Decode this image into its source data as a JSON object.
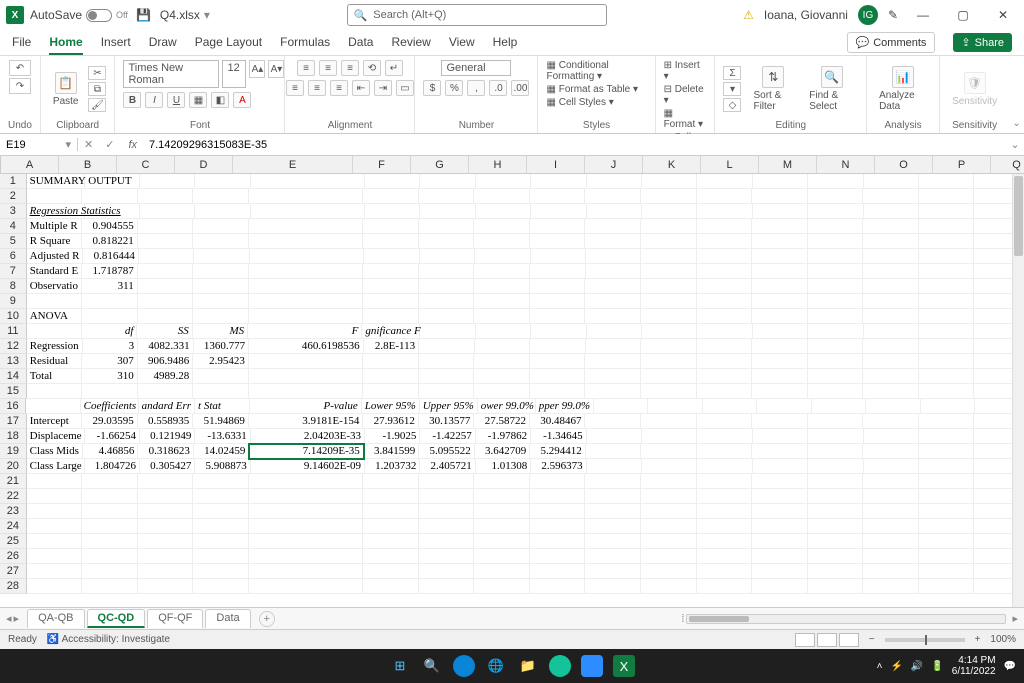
{
  "titlebar": {
    "autosave_label": "AutoSave",
    "autosave_state": "Off",
    "filename": "Q4.xlsx",
    "search_placeholder": "Search (Alt+Q)",
    "username": "Ioana, Giovanni",
    "user_initials": "IG"
  },
  "menu": {
    "tabs": [
      "File",
      "Home",
      "Insert",
      "Draw",
      "Page Layout",
      "Formulas",
      "Data",
      "Review",
      "View",
      "Help"
    ],
    "active_index": 1,
    "comments": "Comments",
    "share": "Share"
  },
  "ribbon": {
    "undo": "Undo",
    "clipboard": "Clipboard",
    "font_name": "Times New Roman",
    "font_size": "12",
    "font_label": "Font",
    "alignment_label": "Alignment",
    "number_format": "General",
    "number_label": "Number",
    "styles": {
      "cond": "Conditional Formatting",
      "table": "Format as Table",
      "cell": "Cell Styles",
      "label": "Styles"
    },
    "cells": {
      "insert": "Insert",
      "delete": "Delete",
      "format": "Format",
      "label": "Cells"
    },
    "editing": {
      "sort": "Sort & Filter",
      "find": "Find & Select",
      "label": "Editing"
    },
    "analysis": {
      "analyze": "Analyze Data",
      "label": "Analysis"
    },
    "sensitivity": {
      "btn": "Sensitivity",
      "label": "Sensitivity"
    }
  },
  "formula_bar": {
    "cell_ref": "E19",
    "formula": "7.14209296315083E-35"
  },
  "columns": [
    {
      "l": "A",
      "w": 58
    },
    {
      "l": "B",
      "w": 58
    },
    {
      "l": "C",
      "w": 58
    },
    {
      "l": "D",
      "w": 58
    },
    {
      "l": "E",
      "w": 120
    },
    {
      "l": "F",
      "w": 58
    },
    {
      "l": "G",
      "w": 58
    },
    {
      "l": "H",
      "w": 58
    },
    {
      "l": "I",
      "w": 58
    },
    {
      "l": "J",
      "w": 58
    },
    {
      "l": "K",
      "w": 58
    },
    {
      "l": "L",
      "w": 58
    },
    {
      "l": "M",
      "w": 58
    },
    {
      "l": "N",
      "w": 58
    },
    {
      "l": "O",
      "w": 58
    },
    {
      "l": "P",
      "w": 58
    },
    {
      "l": "Q",
      "w": 52
    }
  ],
  "row_count": 28,
  "cells": {
    "1": {
      "A": {
        "t": "SUMMARY OUTPUT",
        "span": 3
      }
    },
    "3": {
      "A": {
        "t": "Regression Statistics",
        "span": 3,
        "ital": true,
        "u": true
      }
    },
    "4": {
      "A": {
        "t": "Multiple R",
        "span": 1
      },
      "B": {
        "t": "0.904555",
        "num": true
      }
    },
    "5": {
      "A": {
        "t": "R Square"
      },
      "B": {
        "t": "0.818221",
        "num": true
      }
    },
    "6": {
      "A": {
        "t": "Adjusted R"
      },
      "B": {
        "t": "0.816444",
        "num": true
      }
    },
    "7": {
      "A": {
        "t": "Standard E"
      },
      "B": {
        "t": "1.718787",
        "num": true
      }
    },
    "8": {
      "A": {
        "t": "Observatio"
      },
      "B": {
        "t": "311",
        "num": true
      }
    },
    "10": {
      "A": {
        "t": "ANOVA"
      }
    },
    "11": {
      "B": {
        "t": "df",
        "ital": true,
        "num": true
      },
      "C": {
        "t": "SS",
        "ital": true,
        "num": true
      },
      "D": {
        "t": "MS",
        "ital": true,
        "num": true
      },
      "E": {
        "t": "F",
        "ital": true,
        "num": true
      },
      "F": {
        "t": "gnificance F",
        "ital": true
      }
    },
    "12": {
      "A": {
        "t": "Regression"
      },
      "B": {
        "t": "3",
        "num": true
      },
      "C": {
        "t": "4082.331",
        "num": true
      },
      "D": {
        "t": "1360.777",
        "num": true
      },
      "E": {
        "t": "460.6198536",
        "num": true
      },
      "F": {
        "t": "2.8E-113",
        "num": true
      }
    },
    "13": {
      "A": {
        "t": "Residual"
      },
      "B": {
        "t": "307",
        "num": true
      },
      "C": {
        "t": "906.9486",
        "num": true
      },
      "D": {
        "t": "2.95423",
        "num": true
      }
    },
    "14": {
      "A": {
        "t": "Total"
      },
      "B": {
        "t": "310",
        "num": true
      },
      "C": {
        "t": "4989.28",
        "num": true
      }
    },
    "16": {
      "B": {
        "t": "Coefficients",
        "ital": true
      },
      "C": {
        "t": "andard Err",
        "ital": true
      },
      "D": {
        "t": "t Stat",
        "ital": true
      },
      "E": {
        "t": "P-value",
        "ital": true,
        "num": true
      },
      "F": {
        "t": "Lower 95%",
        "ital": true
      },
      "G": {
        "t": "Upper 95%",
        "ital": true
      },
      "H": {
        "t": "ower 99.0%",
        "ital": true
      },
      "I": {
        "t": "pper 99.0%",
        "ital": true
      }
    },
    "17": {
      "A": {
        "t": "Intercept"
      },
      "B": {
        "t": "29.03595",
        "num": true
      },
      "C": {
        "t": "0.558935",
        "num": true
      },
      "D": {
        "t": "51.94869",
        "num": true
      },
      "E": {
        "t": "3.9181E-154",
        "num": true
      },
      "F": {
        "t": "27.93612",
        "num": true
      },
      "G": {
        "t": "30.13577",
        "num": true
      },
      "H": {
        "t": "27.58722",
        "num": true
      },
      "I": {
        "t": "30.48467",
        "num": true
      }
    },
    "18": {
      "A": {
        "t": "Displaceme"
      },
      "B": {
        "t": "-1.66254",
        "num": true
      },
      "C": {
        "t": "0.121949",
        "num": true
      },
      "D": {
        "t": "-13.6331",
        "num": true
      },
      "E": {
        "t": "2.04203E-33",
        "num": true
      },
      "F": {
        "t": "-1.9025",
        "num": true
      },
      "G": {
        "t": "-1.42257",
        "num": true
      },
      "H": {
        "t": "-1.97862",
        "num": true
      },
      "I": {
        "t": "-1.34645",
        "num": true
      }
    },
    "19": {
      "A": {
        "t": "Class Mids"
      },
      "B": {
        "t": "4.46856",
        "num": true
      },
      "C": {
        "t": "0.318623",
        "num": true
      },
      "D": {
        "t": "14.02459",
        "num": true
      },
      "E": {
        "t": "7.14209E-35",
        "num": true,
        "sel": true
      },
      "F": {
        "t": "3.841599",
        "num": true
      },
      "G": {
        "t": "5.095522",
        "num": true
      },
      "H": {
        "t": "3.642709",
        "num": true
      },
      "I": {
        "t": "5.294412",
        "num": true
      }
    },
    "20": {
      "A": {
        "t": "Class Large"
      },
      "B": {
        "t": "1.804726",
        "num": true
      },
      "C": {
        "t": "0.305427",
        "num": true
      },
      "D": {
        "t": "5.908873",
        "num": true
      },
      "E": {
        "t": "9.14602E-09",
        "num": true
      },
      "F": {
        "t": "1.203732",
        "num": true
      },
      "G": {
        "t": "2.405721",
        "num": true
      },
      "H": {
        "t": "1.01308",
        "num": true
      },
      "I": {
        "t": "2.596373",
        "num": true
      }
    }
  },
  "sheets": {
    "tabs": [
      "QA-QB",
      "QC-QD",
      "QF-QF",
      "Data"
    ],
    "active_index": 1
  },
  "statusbar": {
    "ready": "Ready",
    "accessibility": "Accessibility: Investigate",
    "zoom": "100%"
  },
  "taskbar": {
    "time": "4:14 PM",
    "date": "6/11/2022"
  }
}
